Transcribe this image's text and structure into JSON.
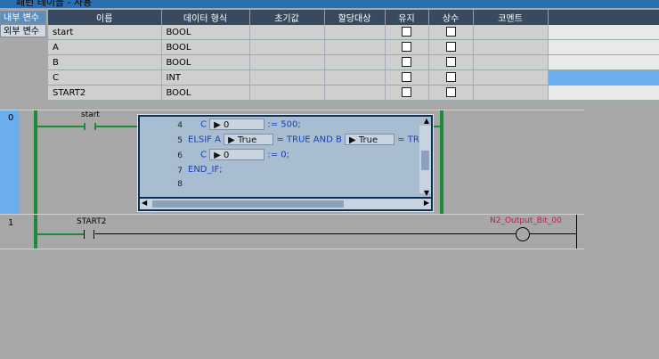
{
  "window": {
    "title": "패턴 테이블 - 사용"
  },
  "tabs": [
    {
      "label": "내부 변수"
    },
    {
      "label": "외부 변수"
    }
  ],
  "table": {
    "headers": [
      "이름",
      "데이터 형식",
      "초기값",
      "할당대상",
      "유지",
      "상수",
      "코멘트"
    ],
    "rows": [
      {
        "name": "start",
        "type": "BOOL",
        "initial": "",
        "assign": "",
        "comment": ""
      },
      {
        "name": "A",
        "type": "BOOL",
        "initial": "",
        "assign": "",
        "comment": ""
      },
      {
        "name": "B",
        "type": "BOOL",
        "initial": "",
        "assign": "",
        "comment": ""
      },
      {
        "name": "C",
        "type": "INT",
        "initial": "",
        "assign": "",
        "comment": ""
      },
      {
        "name": "START2",
        "type": "BOOL",
        "initial": "",
        "assign": "",
        "comment": ""
      }
    ]
  },
  "ladder": {
    "rung0": {
      "number": "0",
      "contact_label": "start"
    },
    "rung1": {
      "number": "1",
      "contact_label": "START2",
      "coil_label": "N2_Output_Bit_00"
    }
  },
  "st_editor": {
    "lines": [
      {
        "num": "4",
        "prefix": "C",
        "value": "0",
        "suffix": ":= 500;"
      },
      {
        "num": "5",
        "prefix": "ELSIF A",
        "value": "True",
        "mid": "= TRUE AND B",
        "value2": "True",
        "suffix": "= TR"
      },
      {
        "num": "6",
        "prefix": "C",
        "value": "0",
        "suffix": ":= 0;"
      },
      {
        "num": "7",
        "text": "END_IF;"
      },
      {
        "num": "8",
        "text": ""
      }
    ]
  },
  "colors": {
    "accent": "#2b6fb0",
    "selected": "#6aaeed",
    "ladder": "#1e8a3a",
    "st_keyword": "#1a3eb8",
    "coil_label": "#c0185c"
  }
}
